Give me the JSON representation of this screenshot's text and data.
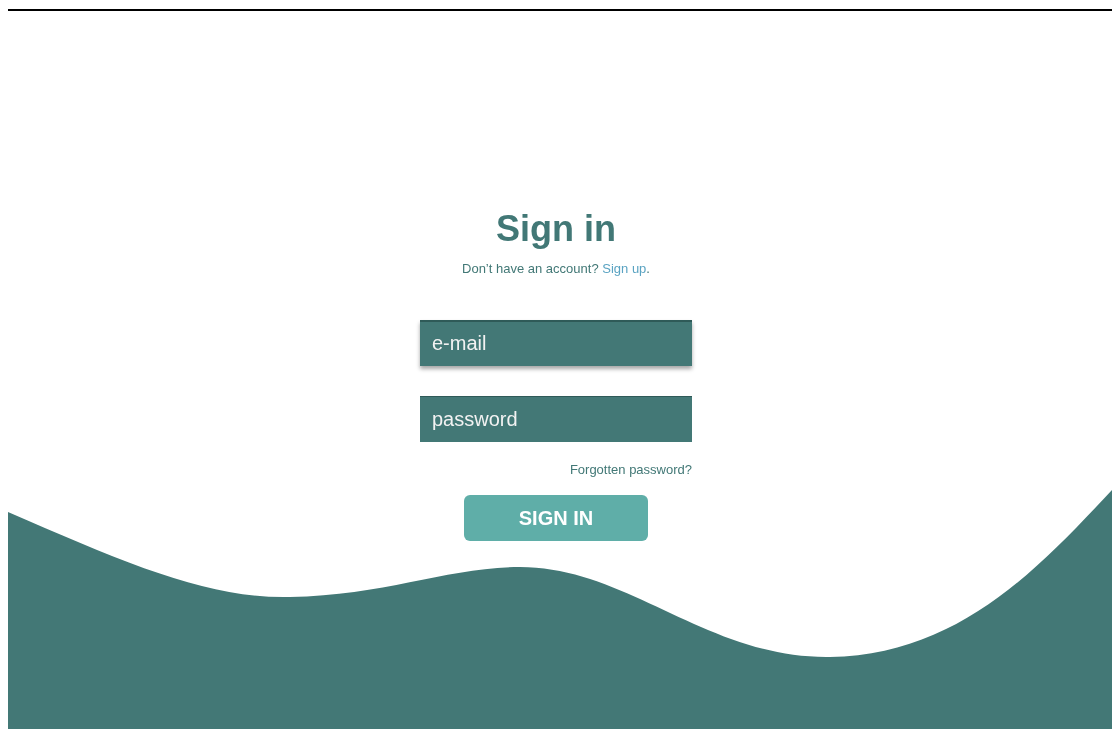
{
  "title": "Sign in",
  "prompt": {
    "text": "Don’t have an account?",
    "link": "Sign up",
    "after": "."
  },
  "fields": [
    {
      "kind": "email",
      "placeholder": "e-mail"
    },
    {
      "kind": "password",
      "placeholder": "password"
    }
  ],
  "forgot_link": "Forgotten password?",
  "submit": "SIGN IN"
}
